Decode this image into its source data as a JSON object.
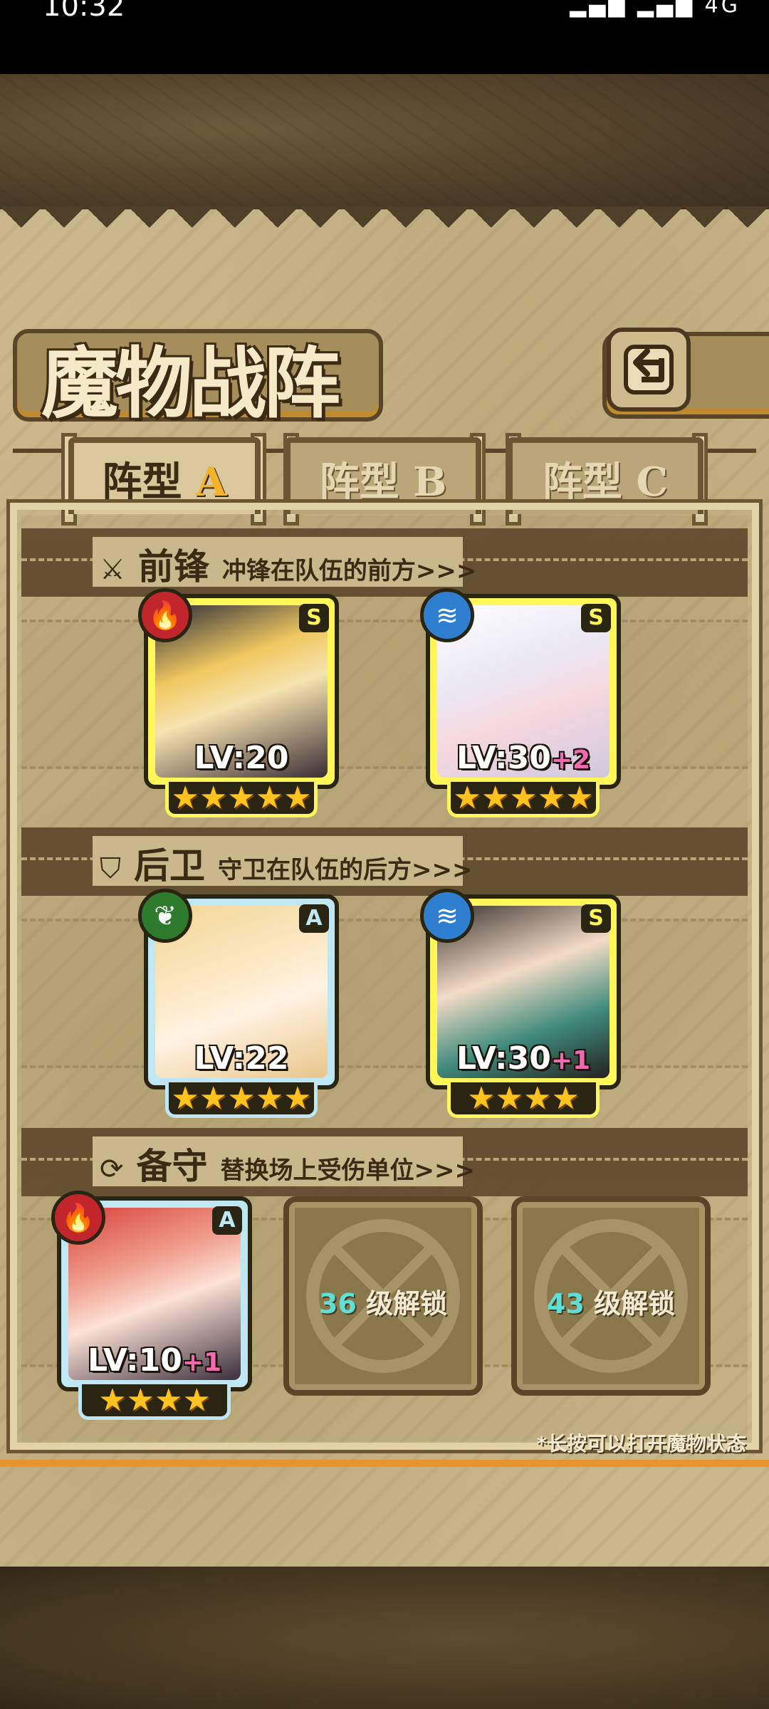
{
  "status_bar": {
    "time": "10:32",
    "signal": "4G"
  },
  "header": {
    "title": "魔物战阵"
  },
  "tabs": [
    {
      "prefix": "阵型",
      "letter": "A",
      "active": true
    },
    {
      "prefix": "阵型",
      "letter": "B",
      "active": false
    },
    {
      "prefix": "阵型",
      "letter": "C",
      "active": false
    }
  ],
  "sections": {
    "front": {
      "name": "前锋",
      "desc": "冲锋在队伍的前方>>>"
    },
    "back": {
      "name": "后卫",
      "desc": "守卫在队伍的后方>>>"
    },
    "reserve": {
      "name": "备守",
      "desc": "替换场上受伤单位>>>"
    }
  },
  "units": [
    {
      "rank": "S",
      "element": "fire",
      "level": "LV:20",
      "plus": "",
      "stars": "★★★★★"
    },
    {
      "rank": "S",
      "element": "water",
      "level": "LV:30",
      "plus": "+2",
      "stars": "★★★★★"
    },
    {
      "rank": "A",
      "element": "leaf",
      "level": "LV:22",
      "plus": "",
      "stars": "★★★★★"
    },
    {
      "rank": "S",
      "element": "water",
      "level": "LV:30",
      "plus": "+1",
      "stars": "★★★★"
    },
    {
      "rank": "A",
      "element": "fire",
      "level": "LV:10",
      "plus": "+1",
      "stars": "★★★★"
    }
  ],
  "locked_slots": [
    {
      "level": "36",
      "text": "级解锁"
    },
    {
      "level": "43",
      "text": "级解锁"
    }
  ],
  "hint": "*长按可以打开魔物状态",
  "colors": {
    "s_card": "#fff65a",
    "a_card": "#bfe6f3",
    "fire": "#c0262b",
    "water": "#2f7fd1",
    "leaf": "#2e7b2e"
  }
}
